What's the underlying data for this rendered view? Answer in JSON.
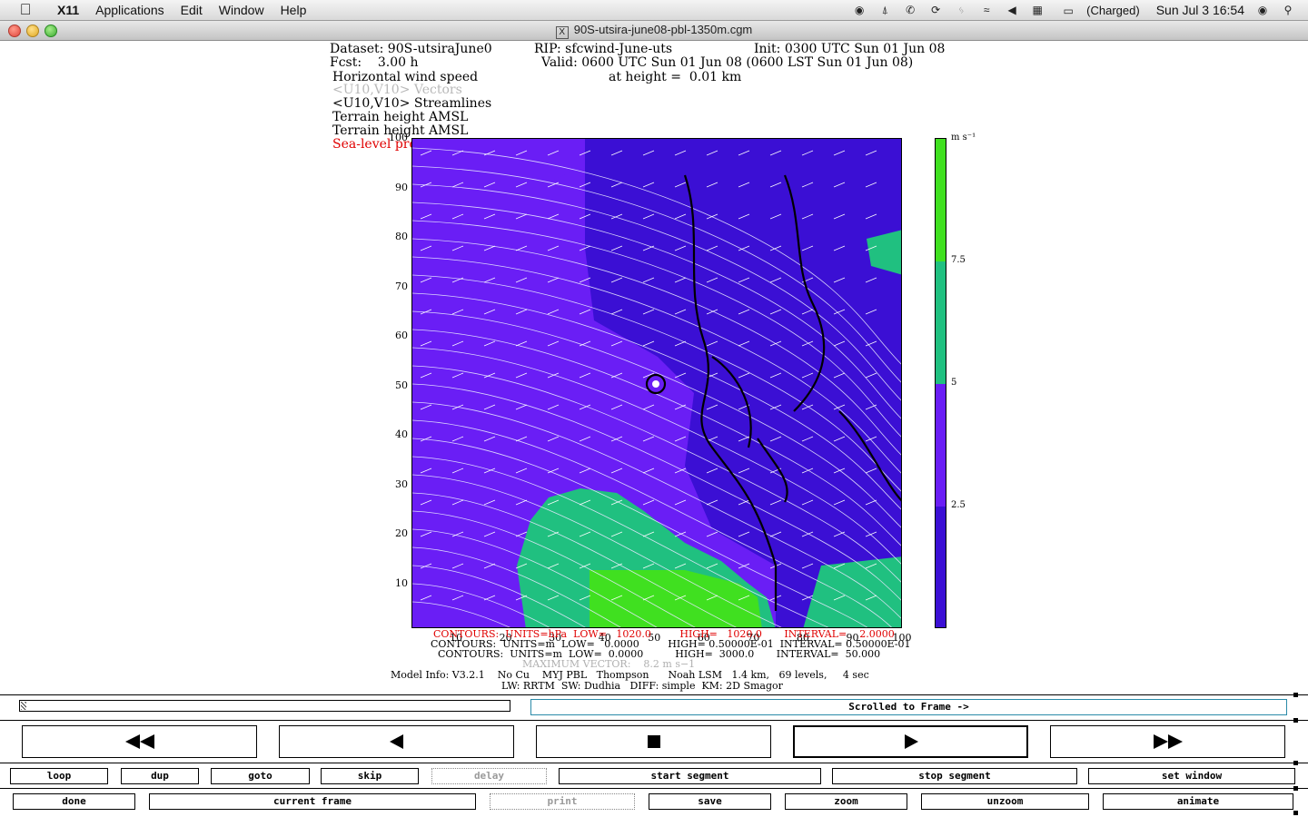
{
  "menubar": {
    "app_name": "X11",
    "items": [
      "Applications",
      "Edit",
      "Window",
      "Help"
    ],
    "battery_text": "(Charged)",
    "clock": "Sun Jul 3  16:54"
  },
  "window": {
    "title": "90S-utsira-june08-pbl-1350m.cgm"
  },
  "plot_header": {
    "line1_left": "Dataset: 90S-utsiraJune0",
    "line1_mid": "RIP: sfcwind-June-uts",
    "line1_right": "Init: 0300 UTC Sun 01 Jun 08",
    "line2_left": "Fcst:    3.00 h",
    "line2_right": "Valid: 0600 UTC Sun 01 Jun 08 (0600 LST Sun 01 Jun 08)",
    "line3_left": "Horizontal wind speed",
    "line3_right": "at height =  0.01 km",
    "line4": "<U10,V10> Vectors",
    "line5": "<U10,V10> Streamlines",
    "line6": "Terrain height AMSL",
    "line7": "Terrain height AMSL",
    "line8": "Sea-level pressure"
  },
  "chart_data": {
    "type": "heatmap",
    "title": "Horizontal wind speed",
    "xlim": [
      1,
      100
    ],
    "ylim": [
      1,
      100
    ],
    "x_ticks": [
      "10",
      "20",
      "30",
      "40",
      "50",
      "60",
      "70",
      "80",
      "90",
      "100"
    ],
    "y_ticks": [
      "10",
      "20",
      "30",
      "40",
      "50",
      "60",
      "70",
      "80",
      "90",
      "100"
    ],
    "colorbar": {
      "unit_label": "m s⁻¹",
      "levels": [
        "2.5",
        "5",
        "7.5"
      ],
      "bins": [
        {
          "range": "0-2.5",
          "color": "#3b0fd4"
        },
        {
          "range": "2.5-5",
          "color": "#6a1ef5"
        },
        {
          "range": "5-7.5",
          "color": "#20c080"
        },
        {
          "range": "7.5+",
          "color": "#40e020"
        }
      ]
    }
  },
  "footer": {
    "contours1": "CONTOURS:  UNITS=hPa  LOW=   1020.0         HIGH=   1020.0       INTERVAL=    2.0000",
    "contours2": "CONTOURS:  UNITS=m  LOW=   0.0000         HIGH= 0.50000E-01  INTERVAL= 0.50000E-01",
    "contours3": "CONTOURS:  UNITS=m  LOW=  0.0000          HIGH=  3000.0       INTERVAL=  50.000",
    "max_vector": "MAXIMUM VECTOR:    8.2 m s−1",
    "model_info1": "Model Info: V3.2.1    No Cu    MYJ PBL   Thompson      Noah LSM   1.4 km,   69 levels,     4 sec",
    "model_info2": "LW: RRTM  SW: Dudhia   DIFF: simple  KM: 2D Smagor"
  },
  "controls": {
    "frame_status": "Scrolled to Frame ->",
    "row1": [
      "loop",
      "dup",
      "goto",
      "skip",
      "delay",
      "start segment",
      "stop segment",
      "set window"
    ],
    "row2": [
      "done",
      "current frame",
      "print",
      "save",
      "zoom",
      "unzoom",
      "animate"
    ]
  }
}
